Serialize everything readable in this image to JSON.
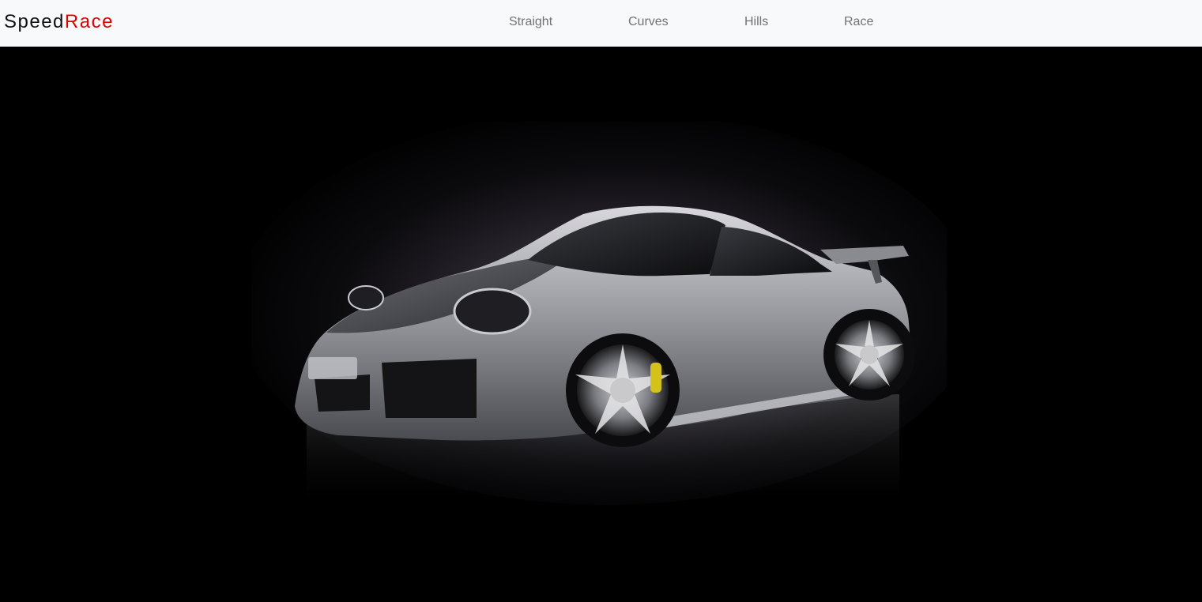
{
  "navbar": {
    "brand": {
      "part1": "Speed",
      "part2": "Race"
    },
    "links": [
      {
        "label": "Straight"
      },
      {
        "label": "Curves"
      },
      {
        "label": "Hills"
      },
      {
        "label": "Race"
      }
    ]
  },
  "hero": {
    "subject": "silver sports car on black studio background",
    "colors": {
      "background": "#000000",
      "car_body": "#a9abb0",
      "brake_caliper": "#d4c21a",
      "brand_accent": "#e00000"
    }
  }
}
